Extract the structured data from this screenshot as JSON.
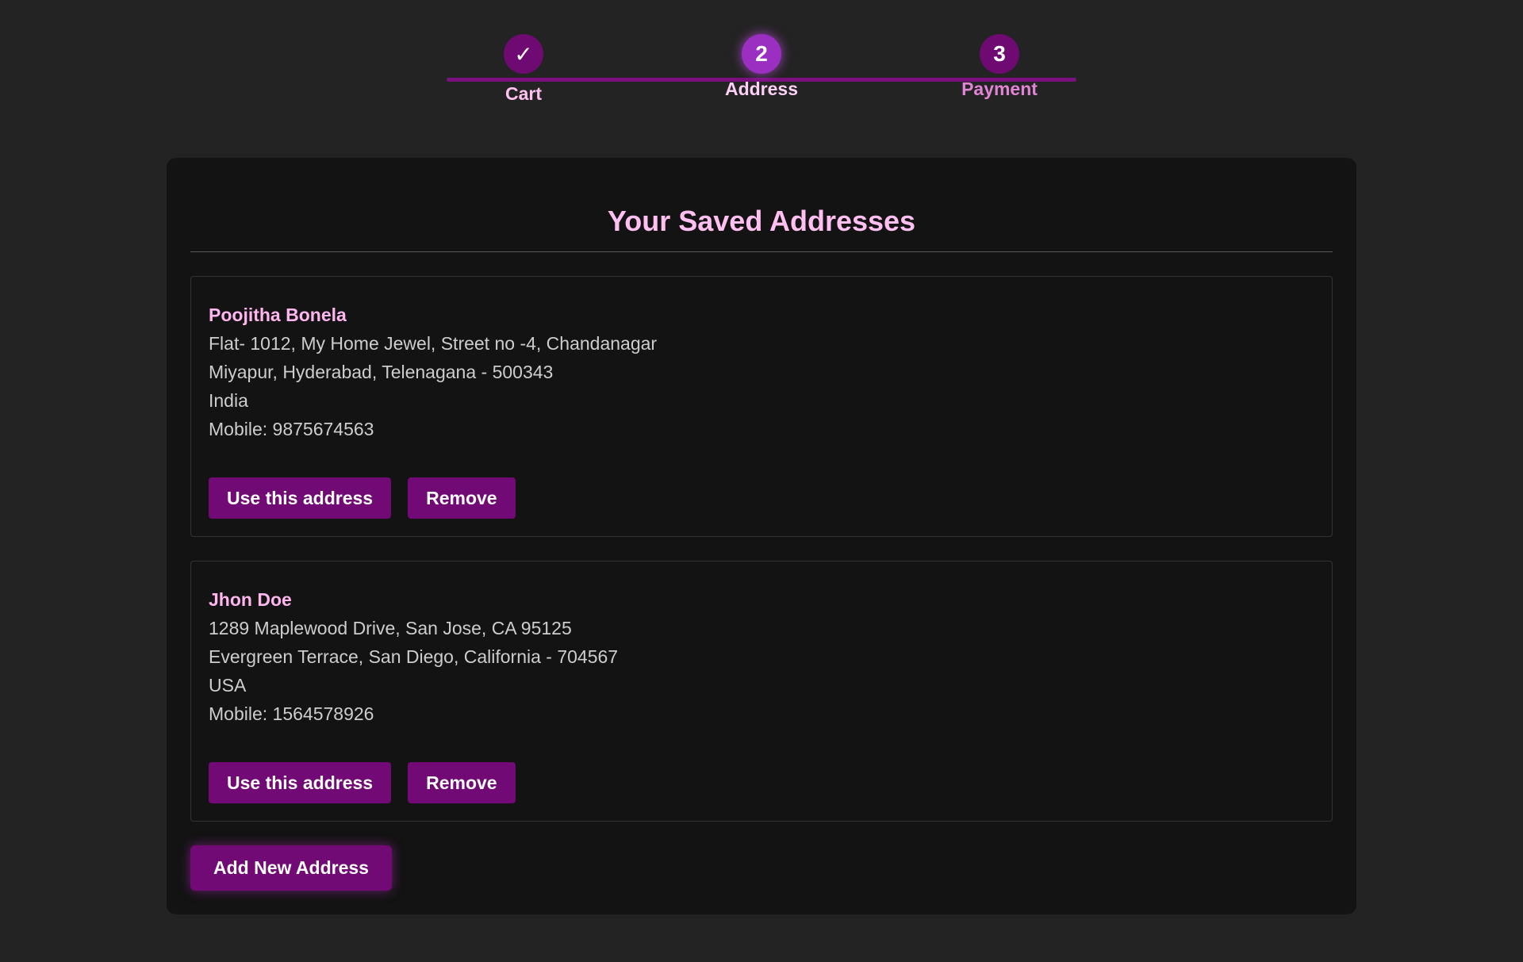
{
  "stepper": {
    "steps": [
      {
        "marker": "✓",
        "label": "Cart",
        "state": "done"
      },
      {
        "marker": "2",
        "label": "Address",
        "state": "active"
      },
      {
        "marker": "3",
        "label": "Payment",
        "state": "pending"
      }
    ]
  },
  "main": {
    "title": "Your Saved Addresses",
    "addresses": [
      {
        "name": "Poojitha Bonela",
        "line1": "Flat- 1012, My Home Jewel, Street no -4, Chandanagar",
        "line2": "Miyapur, Hyderabad, Telenagana - 500343",
        "country": "India",
        "mobile": "Mobile: 9875674563",
        "use_label": "Use this address",
        "remove_label": "Remove"
      },
      {
        "name": "Jhon Doe",
        "line1": "1289 Maplewood Drive, San Jose, CA 95125",
        "line2": "Evergreen Terrace, San Diego, California - 704567",
        "country": "USA",
        "mobile": "Mobile: 1564578926",
        "use_label": "Use this address",
        "remove_label": "Remove"
      }
    ],
    "add_label": "Add New Address"
  },
  "colors": {
    "background": "#232323",
    "card": "#131313",
    "accent": "#720a75",
    "active_step": "#9b2fc1",
    "heading_pink": "#ffbff0",
    "body_text": "#cdcdcd"
  }
}
